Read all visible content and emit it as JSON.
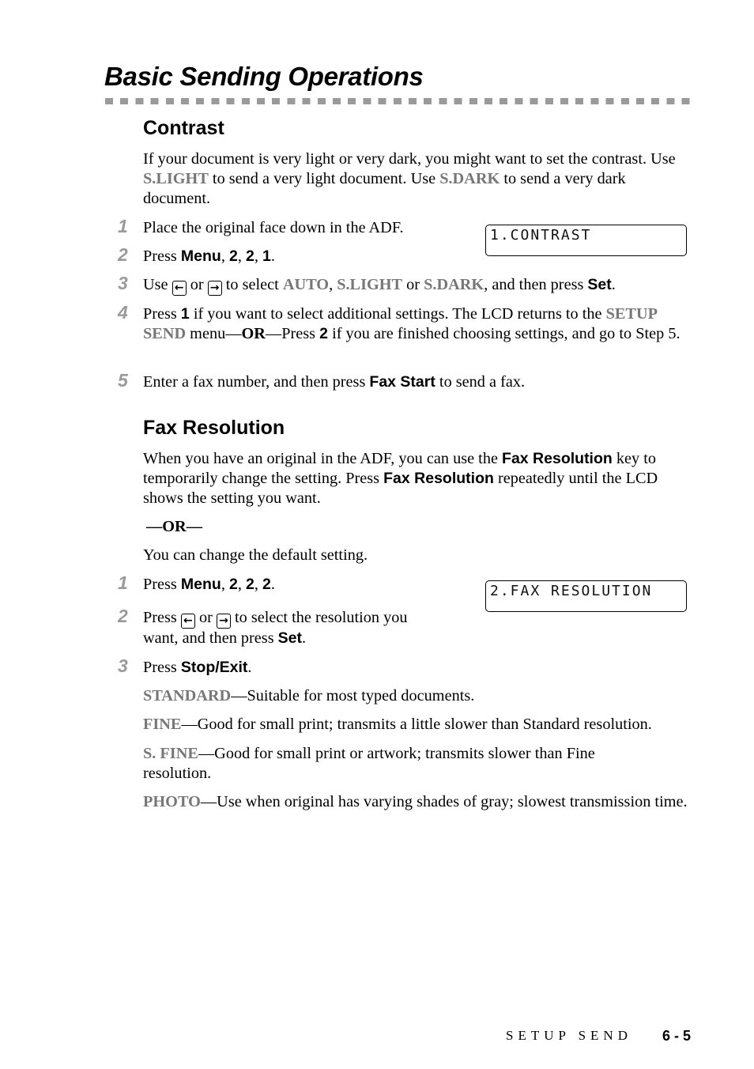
{
  "page_title": "Basic Sending Operations",
  "contrast": {
    "heading": "Contrast",
    "intro": {
      "t1": "If your document is very light or very dark, you might want to set the contrast. Use ",
      "k1": "S.LIGHT",
      "t2": " to send a very light document. Use ",
      "k2": "S.DARK",
      "t3": " to send a very dark document."
    },
    "lcd": "1.CONTRAST",
    "steps": [
      {
        "num": "1",
        "text": "Place the original face down in the ADF."
      },
      {
        "num": "2",
        "pre": "Press ",
        "b1": "Menu",
        "sep1": ", ",
        "b2": "2",
        "sep2": ", ",
        "b3": "2",
        "sep3": ", ",
        "b4": "1",
        "end": "."
      },
      {
        "num": "3",
        "pre": "Use ",
        "or": " or ",
        "mid": " to select ",
        "o1": "AUTO",
        "c1": ", ",
        "o2": "S.LIGHT",
        "c2": " or ",
        "o3": "S.DARK",
        "post": ", and then press ",
        "b": "Set",
        "end": "."
      },
      {
        "num": "4",
        "pre": "Press ",
        "b1": "1",
        "t1": " if you want to select additional settings. The LCD returns to the ",
        "g": "SETUP SEND",
        "t2": " menu—",
        "or": "OR",
        "t3": "—Press ",
        "b2": "2",
        "t4": " if you are finished choosing settings, and go to Step 5."
      },
      {
        "num": "5",
        "pre": "Enter a fax number, and then press ",
        "b": "Fax Start",
        "post": " to send a fax."
      }
    ]
  },
  "fax_resolution": {
    "heading": "Fax Resolution",
    "intro": {
      "t1": "When you have an original in the ADF, you can use the ",
      "b1": "Fax Resolution",
      "t2": " key to temporarily change the setting. Press ",
      "b2": "Fax Resolution",
      "t3": " repeatedly until the LCD shows the setting you want."
    },
    "or_line": "—OR—",
    "default_line": "You can change the default setting.",
    "lcd": "2.FAX RESOLUTION",
    "steps": [
      {
        "num": "1",
        "pre": "Press ",
        "b1": "Menu",
        "sep1": ", ",
        "b2": "2",
        "sep2": ", ",
        "b3": "2",
        "sep3": ", ",
        "b4": "2",
        "end": "."
      },
      {
        "num": "2",
        "pre": "Press ",
        "or": " or ",
        "mid": " to select the resolution you want, and then press ",
        "b": "Set",
        "end": "."
      },
      {
        "num": "3",
        "pre": "Press ",
        "b": "Stop/Exit",
        "end": "."
      }
    ],
    "options": [
      {
        "name": "STANDARD",
        "desc": "—Suitable for most typed documents."
      },
      {
        "name": "FINE",
        "desc": "—Good for small print; transmits a little slower than Standard resolution."
      },
      {
        "name": "S. FINE",
        "desc": "—Good for small print or artwork; transmits slower than Fine resolution."
      },
      {
        "name": "PHOTO",
        "desc": "—Use when original has varying shades of gray; slowest transmission time."
      }
    ]
  },
  "keys": {
    "left": "←",
    "right": "→"
  },
  "footer": {
    "section": "SETUP SEND",
    "page": "6 - 5"
  }
}
